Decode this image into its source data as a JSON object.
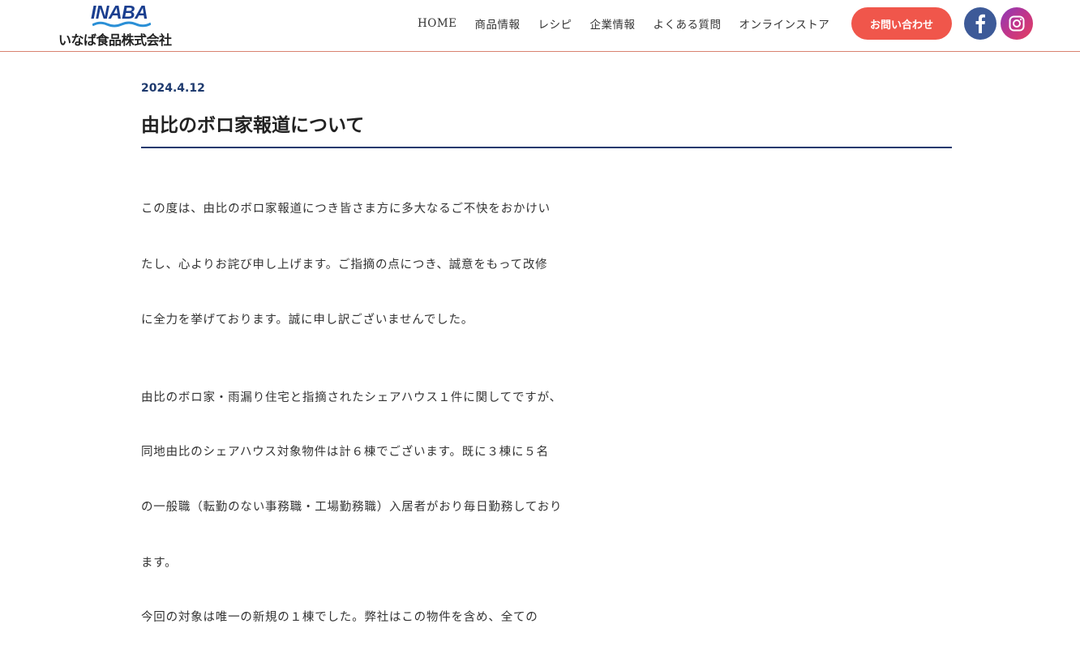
{
  "header": {
    "logo_en": "INABA",
    "logo_jp": "いなば食品株式会社",
    "nav": [
      "HOME",
      "商品情報",
      "レシピ",
      "企業情報",
      "よくある質問",
      "オンラインストア"
    ],
    "contact_label": "お問い合わせ",
    "facebook_glyph": "f"
  },
  "article": {
    "date": "2024.4.12",
    "title": "由比のボロ家報道について",
    "lines": [
      "この度は、由比のボロ家報道につき皆さま方に多大なるご不快をおかけい",
      "たし、心よりお詫び申し上げます。ご指摘の点につき、誠意をもって改修",
      "に全力を挙げております。誠に申し訳ございませんでした。",
      "由比のボロ家・雨漏り住宅と指摘されたシェアハウス１件に関してですが、",
      "同地由比のシェアハウス対象物件は計６棟でございます。既に３棟に５名",
      "の一般職（転勤のない事務職・工場勤務職）入居者がおり毎日勤務しており",
      "ます。",
      "今回の対象は唯一の新規の１棟でした。弊社はこの物件を含め、全ての"
    ]
  },
  "colors": {
    "accent_blue": "#1e3a6e",
    "contact_red": "#f0564b",
    "facebook_blue": "#3d5a98",
    "header_rule": "#d9826f"
  },
  "icons": [
    "facebook-icon",
    "instagram-icon",
    "logo-wave-icon"
  ]
}
